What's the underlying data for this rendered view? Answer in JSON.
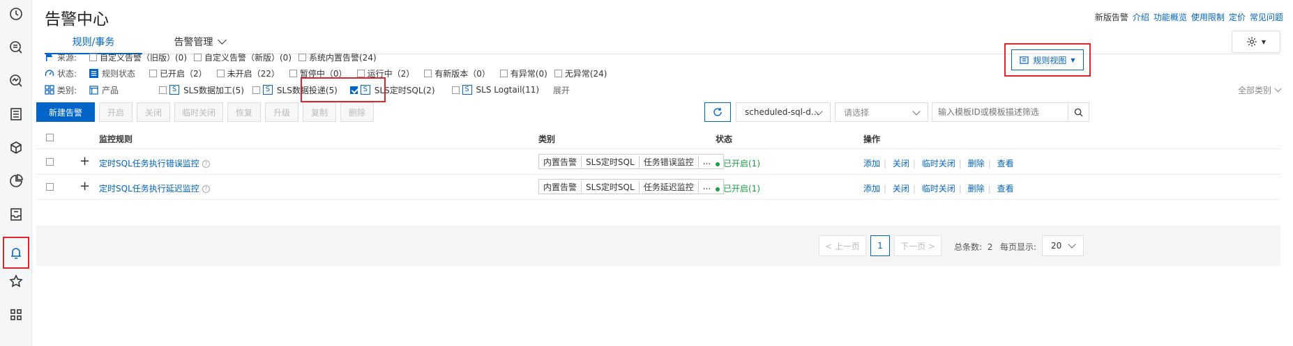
{
  "page": {
    "title": "告警中心",
    "top_links": [
      "新版告警",
      "介绍",
      "功能概览",
      "使用限制",
      "定价",
      "常见问题"
    ]
  },
  "tabs": [
    {
      "label": "规则/事务",
      "active": true
    },
    {
      "label": "告警管理",
      "active": false
    }
  ],
  "view_button": {
    "label": "规则视图"
  },
  "filters": {
    "source": {
      "label": "来源:",
      "options": [
        "自定义告警（旧版）(0)",
        "自定义告警（新版）(0)",
        "系统内置告警(24)"
      ]
    },
    "state": {
      "label": "状态:",
      "group_label": "规则状态",
      "options": [
        "已开启（2）",
        "未开启（22）",
        "暂停中（0）",
        "运行中（2）",
        "有新版本（0）",
        "有异常(0)",
        "无异常(24)"
      ]
    },
    "category": {
      "label": "类别:",
      "group_label": "产品",
      "options": [
        {
          "badge": "S",
          "label": "SLS数据加工(5)",
          "checked": false
        },
        {
          "badge": "S",
          "label": "SLS数据投递(5)",
          "checked": false
        },
        {
          "badge": "S",
          "label": "SLS定时SQL(2)",
          "checked": true
        },
        {
          "badge": "S",
          "label": "SLS Logtail(11)",
          "checked": false
        }
      ],
      "expand": "展开",
      "all_categories": "全部类别"
    }
  },
  "toolbar": {
    "new_alert": "新建告警",
    "buttons": [
      "开启",
      "关闭",
      "临时关闭",
      "恢复",
      "升级",
      "复制",
      "删除"
    ],
    "filter_select_value": "scheduled-sql-d...",
    "second_select_placeholder": "请选择",
    "search_placeholder": "输入模板ID或模板描述筛选"
  },
  "table": {
    "columns": [
      "监控规则",
      "类别",
      "状态",
      "操作"
    ],
    "rows": [
      {
        "rule": "定时SQL任务执行错误监控",
        "tags": [
          "内置告警",
          "SLS定时SQL",
          "任务错误监控",
          "..."
        ],
        "status": "已开启(1)",
        "ops": [
          "添加",
          "关闭",
          "临时关闭",
          "删除",
          "查看"
        ]
      },
      {
        "rule": "定时SQL任务执行延迟监控",
        "tags": [
          "内置告警",
          "SLS定时SQL",
          "任务延迟监控",
          "..."
        ],
        "status": "已开启(1)",
        "ops": [
          "添加",
          "关闭",
          "临时关闭",
          "删除",
          "查看"
        ]
      }
    ]
  },
  "pagination": {
    "prev": "< 上一页",
    "current_page": "1",
    "next": "下一页 >",
    "total_label": "总条数:",
    "total": "2",
    "page_size_label": "每页显示:",
    "page_size": "20"
  }
}
